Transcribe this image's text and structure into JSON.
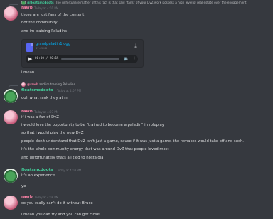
{
  "messages": {
    "m1": {
      "reply_name": "@floatsmcdoots",
      "reply_text": "The unfortunate matter of this fact is that said \"fans\" of your DvZ work possess a high level of real estate over the engagement",
      "author": "rawb",
      "timestamp": "Today at 4:01 PM",
      "lines": [
        "those are just fans of the content",
        "not the community",
        "and im training Paladins"
      ],
      "attachment": {
        "file_name": "grandpaladin1.ogg",
        "file_size": "47.45 KB",
        "time": "00:00 / 20:15"
      },
      "after": "i mean"
    },
    "m2": {
      "reply_name": "@rawb",
      "reply_text": "and im training Paladins",
      "author": "floatsmcdoots",
      "timestamp": "Today at 4:07 PM",
      "lines": [
        "ooh what rank they at rn"
      ]
    },
    "m3": {
      "author": "rawb",
      "timestamp": "Today at 4:07 PM",
      "lines": [
        "if i was a fan of DvZ",
        "i would love the opportunity to be \"trained to become a paladin\" in roleplay",
        "so that i would play the new DvZ",
        "people don't understand that DvZ isn't just a game, cause if it was just a game, the remakes would take off and such.",
        "it's the whole community energy that was around DvZ that people loved most",
        "and unfortunately thats all tied to nostalgia"
      ]
    },
    "m4": {
      "author": "floatsmcdoots",
      "timestamp": "Today at 4:08 PM",
      "lines": [
        "it's an experience",
        "ye"
      ]
    },
    "m5": {
      "author": "rawb",
      "timestamp": "Today at 4:08 PM",
      "lines": [
        "so you really can't do it without Bruce",
        "i mean you can try and you can get close"
      ]
    }
  },
  "colors": {
    "background": "#36393f",
    "rawb_name": "#f47fa3",
    "floats_name": "#43d19c",
    "link": "#00aff4"
  },
  "icons": [
    "file-icon",
    "download-icon",
    "play-icon",
    "volume-icon",
    "more-icon",
    "reply-arrow-icon"
  ]
}
